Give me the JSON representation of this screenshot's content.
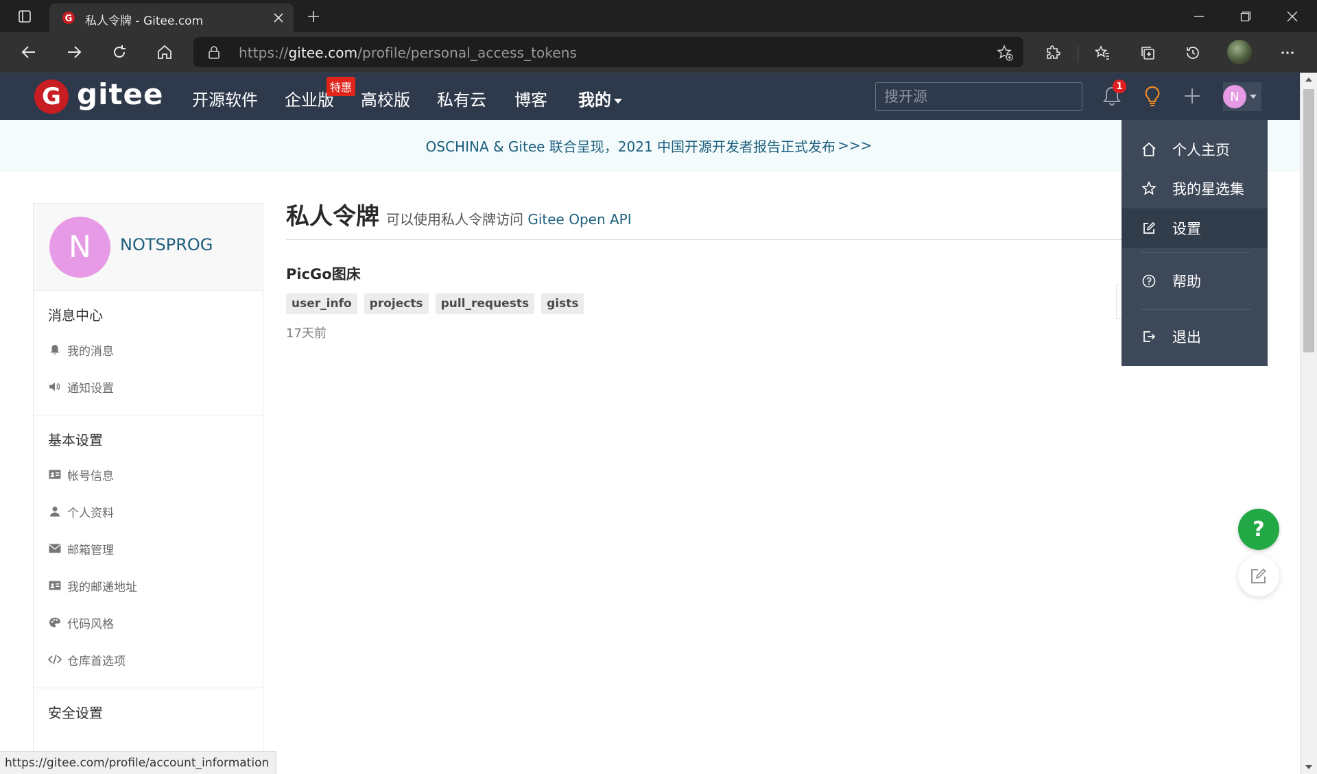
{
  "browser": {
    "tab_title": "私人令牌 - Gitee.com",
    "url_scheme": "https://",
    "url_host": "gitee.com",
    "url_path": "/profile/personal_access_tokens",
    "status_url": "https://gitee.com/profile/account_information"
  },
  "header": {
    "logo_text": "gitee",
    "logo_mark": "G",
    "nav": [
      "开源软件",
      "企业版",
      "高校版",
      "私有云",
      "博客",
      "我的"
    ],
    "hot_badge": "特惠",
    "search_placeholder": "搜开源",
    "notification_count": "1",
    "avatar_letter": "N"
  },
  "banner": {
    "text": "OSCHINA & Gitee 联合呈现，2021 中国开源开发者报告正式发布",
    "arrows": ">>>"
  },
  "sidebar": {
    "avatar_letter": "N",
    "username": "NOTSPROG",
    "sections": [
      {
        "title": "消息中心",
        "items": [
          "我的消息",
          "通知设置"
        ]
      },
      {
        "title": "基本设置",
        "items": [
          "帐号信息",
          "个人资料",
          "邮箱管理",
          "我的邮递地址",
          "代码风格",
          "仓库首选项"
        ]
      },
      {
        "title": "安全设置",
        "items": []
      }
    ]
  },
  "main": {
    "title": "私人令牌",
    "subtitle_prefix": "可以使用私人令牌访问",
    "subtitle_link": "Gitee Open API",
    "token": {
      "name": "PicGo图床",
      "scopes": [
        "user_info",
        "projects",
        "pull_requests",
        "gists"
      ],
      "time": "17天前"
    }
  },
  "dropdown": {
    "items": [
      "个人主页",
      "我的星选集",
      "设置",
      "帮助",
      "退出"
    ],
    "active": "设置"
  },
  "floating": {
    "help_label": "?"
  },
  "colors": {
    "header_bg": "#2e3a4b",
    "brand_red": "#c71d23",
    "link": "#1c5e7c",
    "avatar": "#e79ae5",
    "help_green": "#22a845"
  }
}
